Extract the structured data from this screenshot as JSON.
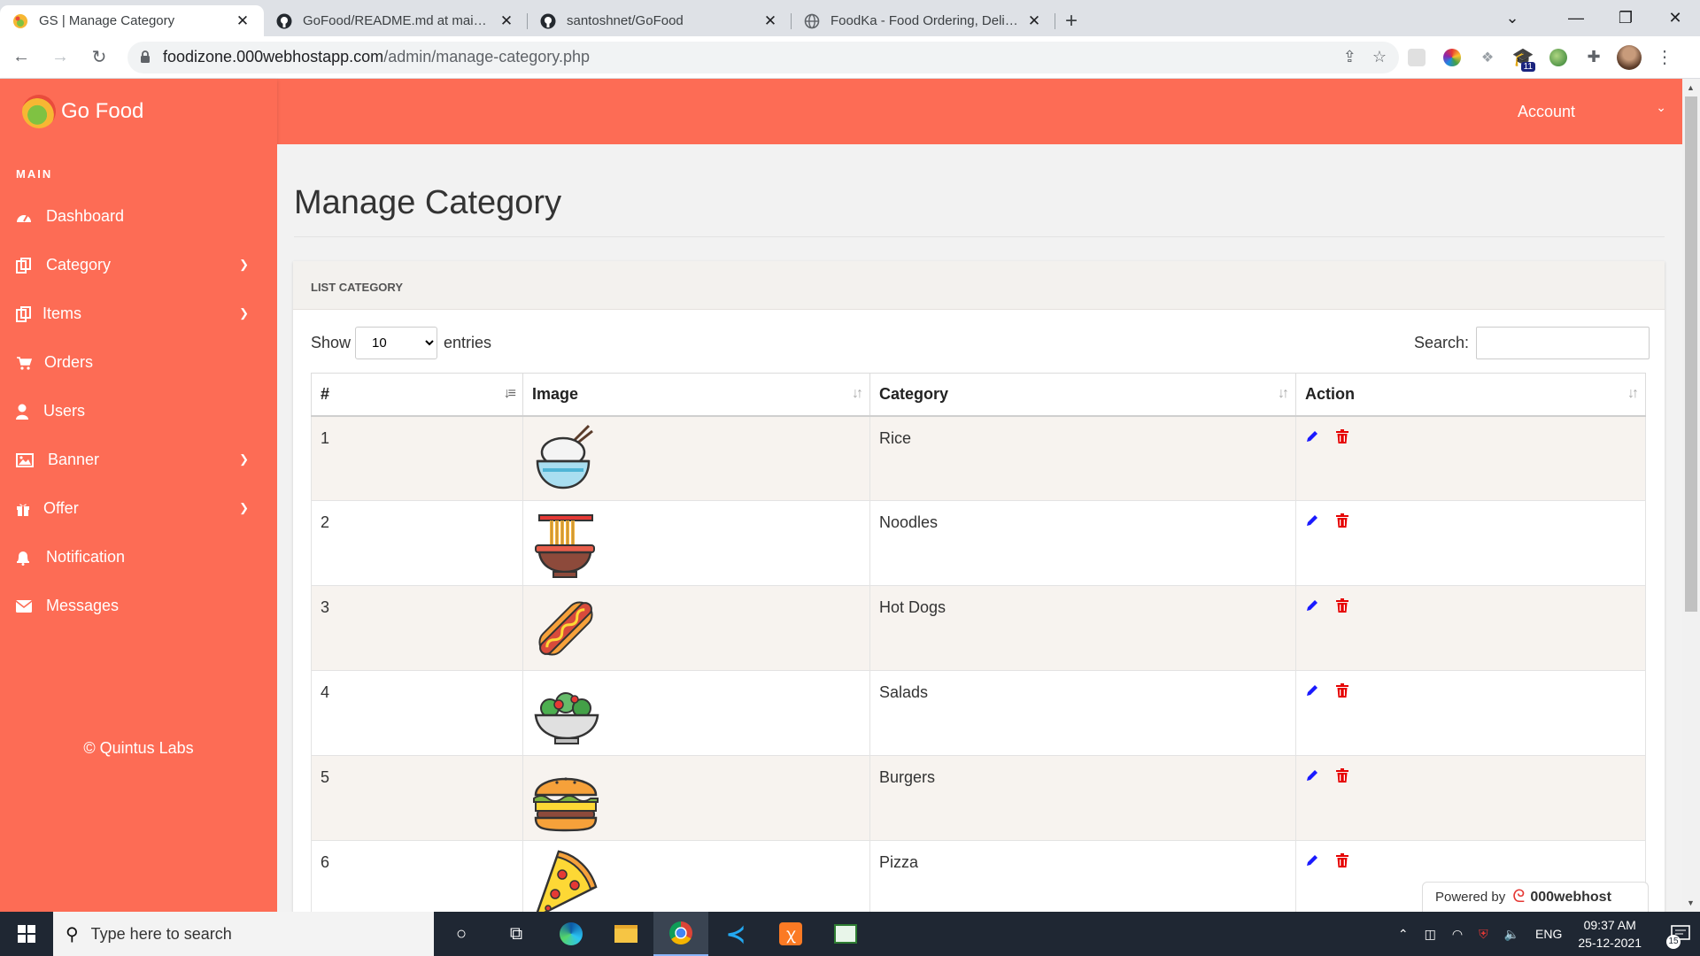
{
  "browser": {
    "tabs": [
      {
        "title": "GS | Manage Category",
        "active": true,
        "favicon": "gofood-logo-icon"
      },
      {
        "title": "GoFood/README.md at main · santoshnet/GoFood",
        "active": false,
        "favicon": "github-icon"
      },
      {
        "title": "santoshnet/GoFood",
        "active": false,
        "favicon": "github-icon"
      },
      {
        "title": "FoodKa - Food Ordering, Delivery",
        "active": false,
        "favicon": "globe-icon"
      }
    ],
    "url_host": "foodizone.000webhostapp.com",
    "url_path": "/admin/manage-category.php",
    "extension_badge": "11"
  },
  "app": {
    "brand": "Go Food",
    "account_label": "Account",
    "sidebar": {
      "section": "MAIN",
      "items": [
        {
          "label": "Dashboard",
          "icon": "dashboard-icon",
          "has_submenu": false
        },
        {
          "label": "Category",
          "icon": "copy-icon",
          "has_submenu": true
        },
        {
          "label": "Items",
          "icon": "copy-icon",
          "has_submenu": true
        },
        {
          "label": "Orders",
          "icon": "cart-icon",
          "has_submenu": false
        },
        {
          "label": "Users",
          "icon": "user-icon",
          "has_submenu": false
        },
        {
          "label": "Banner",
          "icon": "image-icon",
          "has_submenu": true
        },
        {
          "label": "Offer",
          "icon": "gift-icon",
          "has_submenu": true
        },
        {
          "label": "Notification",
          "icon": "bell-icon",
          "has_submenu": false
        },
        {
          "label": "Messages",
          "icon": "envelope-icon",
          "has_submenu": false
        }
      ],
      "copyright": "© Quintus Labs"
    }
  },
  "page": {
    "title": "Manage Category",
    "card_title": "LIST CATEGORY",
    "show_label": "Show",
    "entries_label": "entries",
    "page_length": "10",
    "search_label": "Search:",
    "search_value": "",
    "columns": [
      "#",
      "Image",
      "Category",
      "Action"
    ],
    "rows": [
      {
        "num": "1",
        "category": "Rice",
        "image": "rice-bowl-icon"
      },
      {
        "num": "2",
        "category": "Noodles",
        "image": "noodles-icon"
      },
      {
        "num": "3",
        "category": "Hot Dogs",
        "image": "hot-dog-icon"
      },
      {
        "num": "4",
        "category": "Salads",
        "image": "salad-icon"
      },
      {
        "num": "5",
        "category": "Burgers",
        "image": "burger-icon"
      },
      {
        "num": "6",
        "category": "Pizza",
        "image": "pizza-icon"
      }
    ],
    "powered_by": "Powered by",
    "powered_brand": "000webhost"
  },
  "colors": {
    "brand": "#fd6c55",
    "edit": "#1a1aff",
    "delete": "#e60000"
  },
  "taskbar": {
    "search_placeholder": "Type here to search",
    "language": "ENG",
    "time": "09:37 AM",
    "date": "25-12-2021",
    "notification_count": "15"
  }
}
